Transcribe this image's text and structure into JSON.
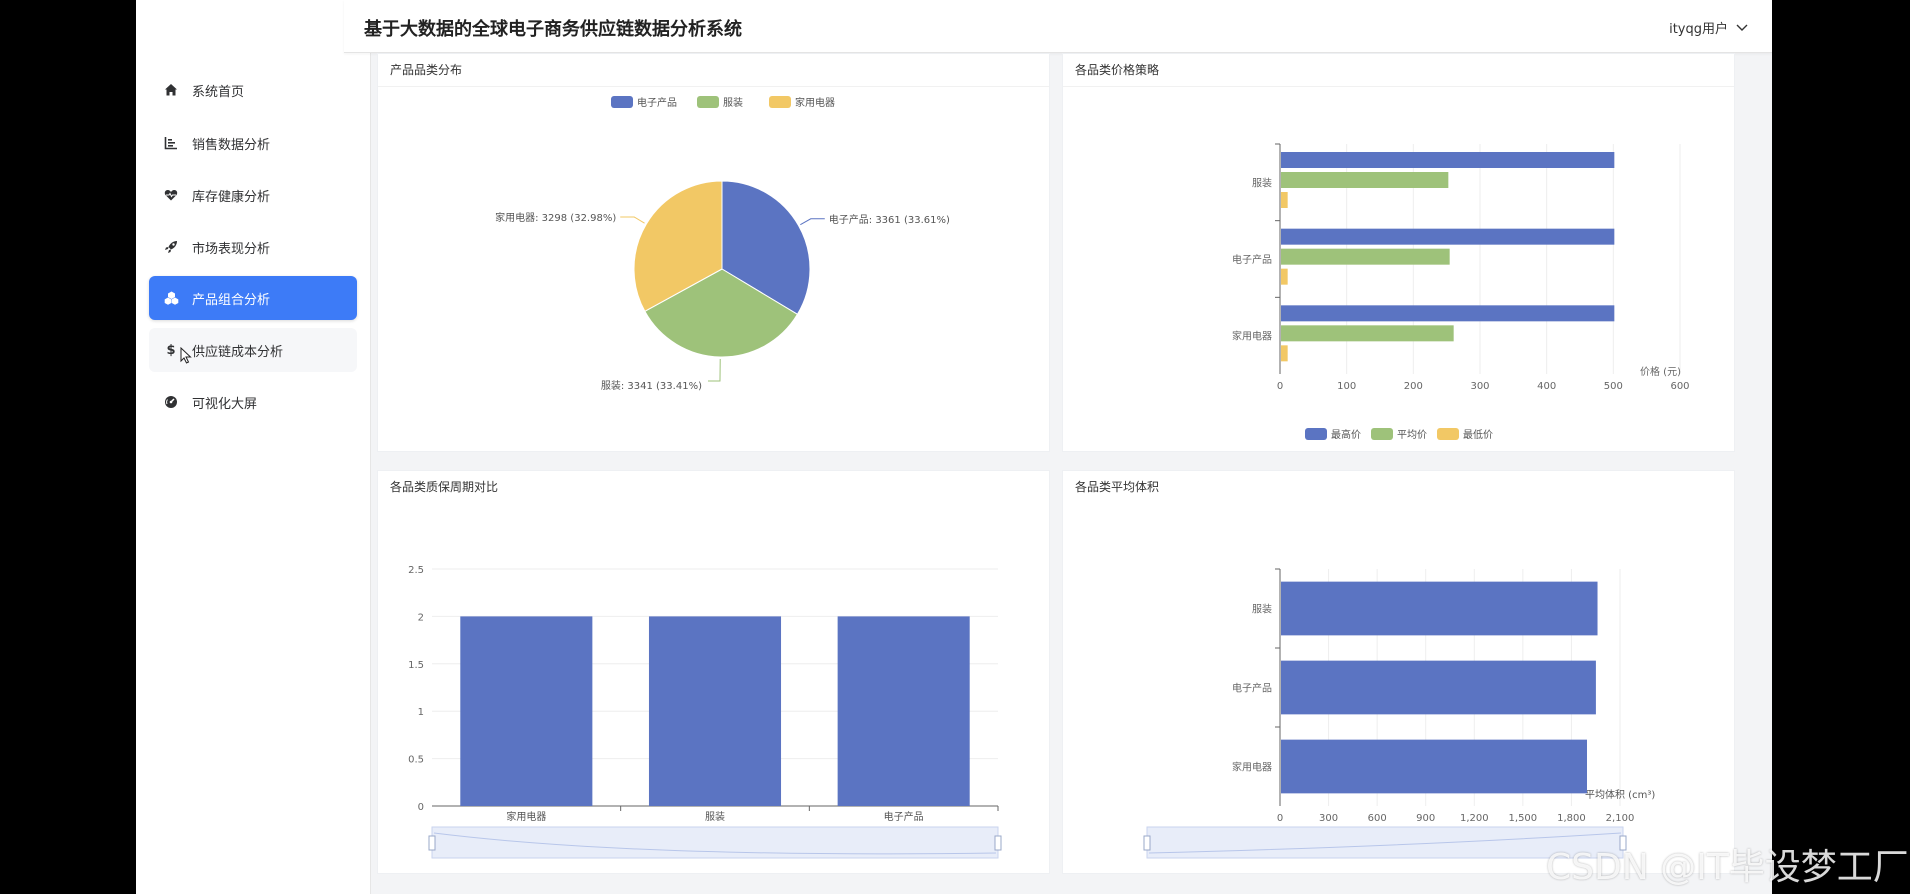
{
  "header": {
    "title": "基于大数据的全球电子商务供应链数据分析系统",
    "user": "ityqg用户"
  },
  "sidebar": {
    "items": [
      {
        "label": "系统首页",
        "icon": "home-icon"
      },
      {
        "label": "销售数据分析",
        "icon": "chart-icon"
      },
      {
        "label": "库存健康分析",
        "icon": "heartbeat-icon"
      },
      {
        "label": "市场表现分析",
        "icon": "rocket-icon"
      },
      {
        "label": "产品组合分析",
        "icon": "cubes-icon",
        "active": true
      },
      {
        "label": "供应链成本分析",
        "icon": "dollar-icon"
      },
      {
        "label": "可视化大屏",
        "icon": "dashboard-icon"
      }
    ]
  },
  "colors": {
    "blue": "#5b74c2",
    "green": "#9ec27a",
    "yellow": "#f2c865",
    "active": "#3d7bf7"
  },
  "cards": {
    "pie": {
      "title": "产品品类分布"
    },
    "price": {
      "title": "各品类价格策略"
    },
    "shelf": {
      "title": "各品类质保周期对比"
    },
    "volume": {
      "title": "各品类平均体积"
    }
  },
  "chart_data": [
    {
      "type": "pie",
      "title": "产品品类分布",
      "legend": [
        "电子产品",
        "服装",
        "家用电器"
      ],
      "slices": [
        {
          "name": "电子产品",
          "value": 3361,
          "label": "电子产品: 3361 (33.61%)"
        },
        {
          "name": "服装",
          "value": 3341,
          "label": "服装: 3341 (33.41%)"
        },
        {
          "name": "家用电器",
          "value": 3298,
          "label": "家用电器: 3298 (32.98%)"
        }
      ],
      "legend_position": "top"
    },
    {
      "type": "bar",
      "orientation": "horizontal",
      "title": "各品类价格策略",
      "categories": [
        "服装",
        "电子产品",
        "家用电器"
      ],
      "series": [
        {
          "name": "最高价",
          "values": [
            500,
            500,
            500
          ]
        },
        {
          "name": "平均价",
          "values": [
            251,
            253,
            259
          ]
        },
        {
          "name": "最低价",
          "values": [
            10,
            10,
            10
          ]
        }
      ],
      "xlabel": "价格 (元)",
      "xlim": [
        0,
        600
      ],
      "xticks": [
        "0",
        "100",
        "200",
        "300",
        "400",
        "500",
        "600"
      ],
      "legend_position": "bottom"
    },
    {
      "type": "bar",
      "title": "各品类质保周期对比",
      "categories": [
        "家用电器",
        "服装",
        "电子产品"
      ],
      "values": [
        2,
        2,
        2
      ],
      "ylim": [
        0,
        2.5
      ],
      "yticks": [
        "0",
        "0.5",
        "1",
        "1.5",
        "2",
        "2.5"
      ]
    },
    {
      "type": "bar",
      "orientation": "horizontal",
      "title": "各品类平均体积",
      "categories": [
        "服装",
        "电子产品",
        "家用电器"
      ],
      "values": [
        1955,
        1945,
        1890
      ],
      "xlabel": "平均体积 (cm³)",
      "xlim": [
        0,
        2100
      ],
      "xticks": [
        "0",
        "300",
        "600",
        "900",
        "1,200",
        "1,500",
        "1,800",
        "2,100"
      ]
    }
  ],
  "watermark": "CSDN @IT毕设梦工厂"
}
